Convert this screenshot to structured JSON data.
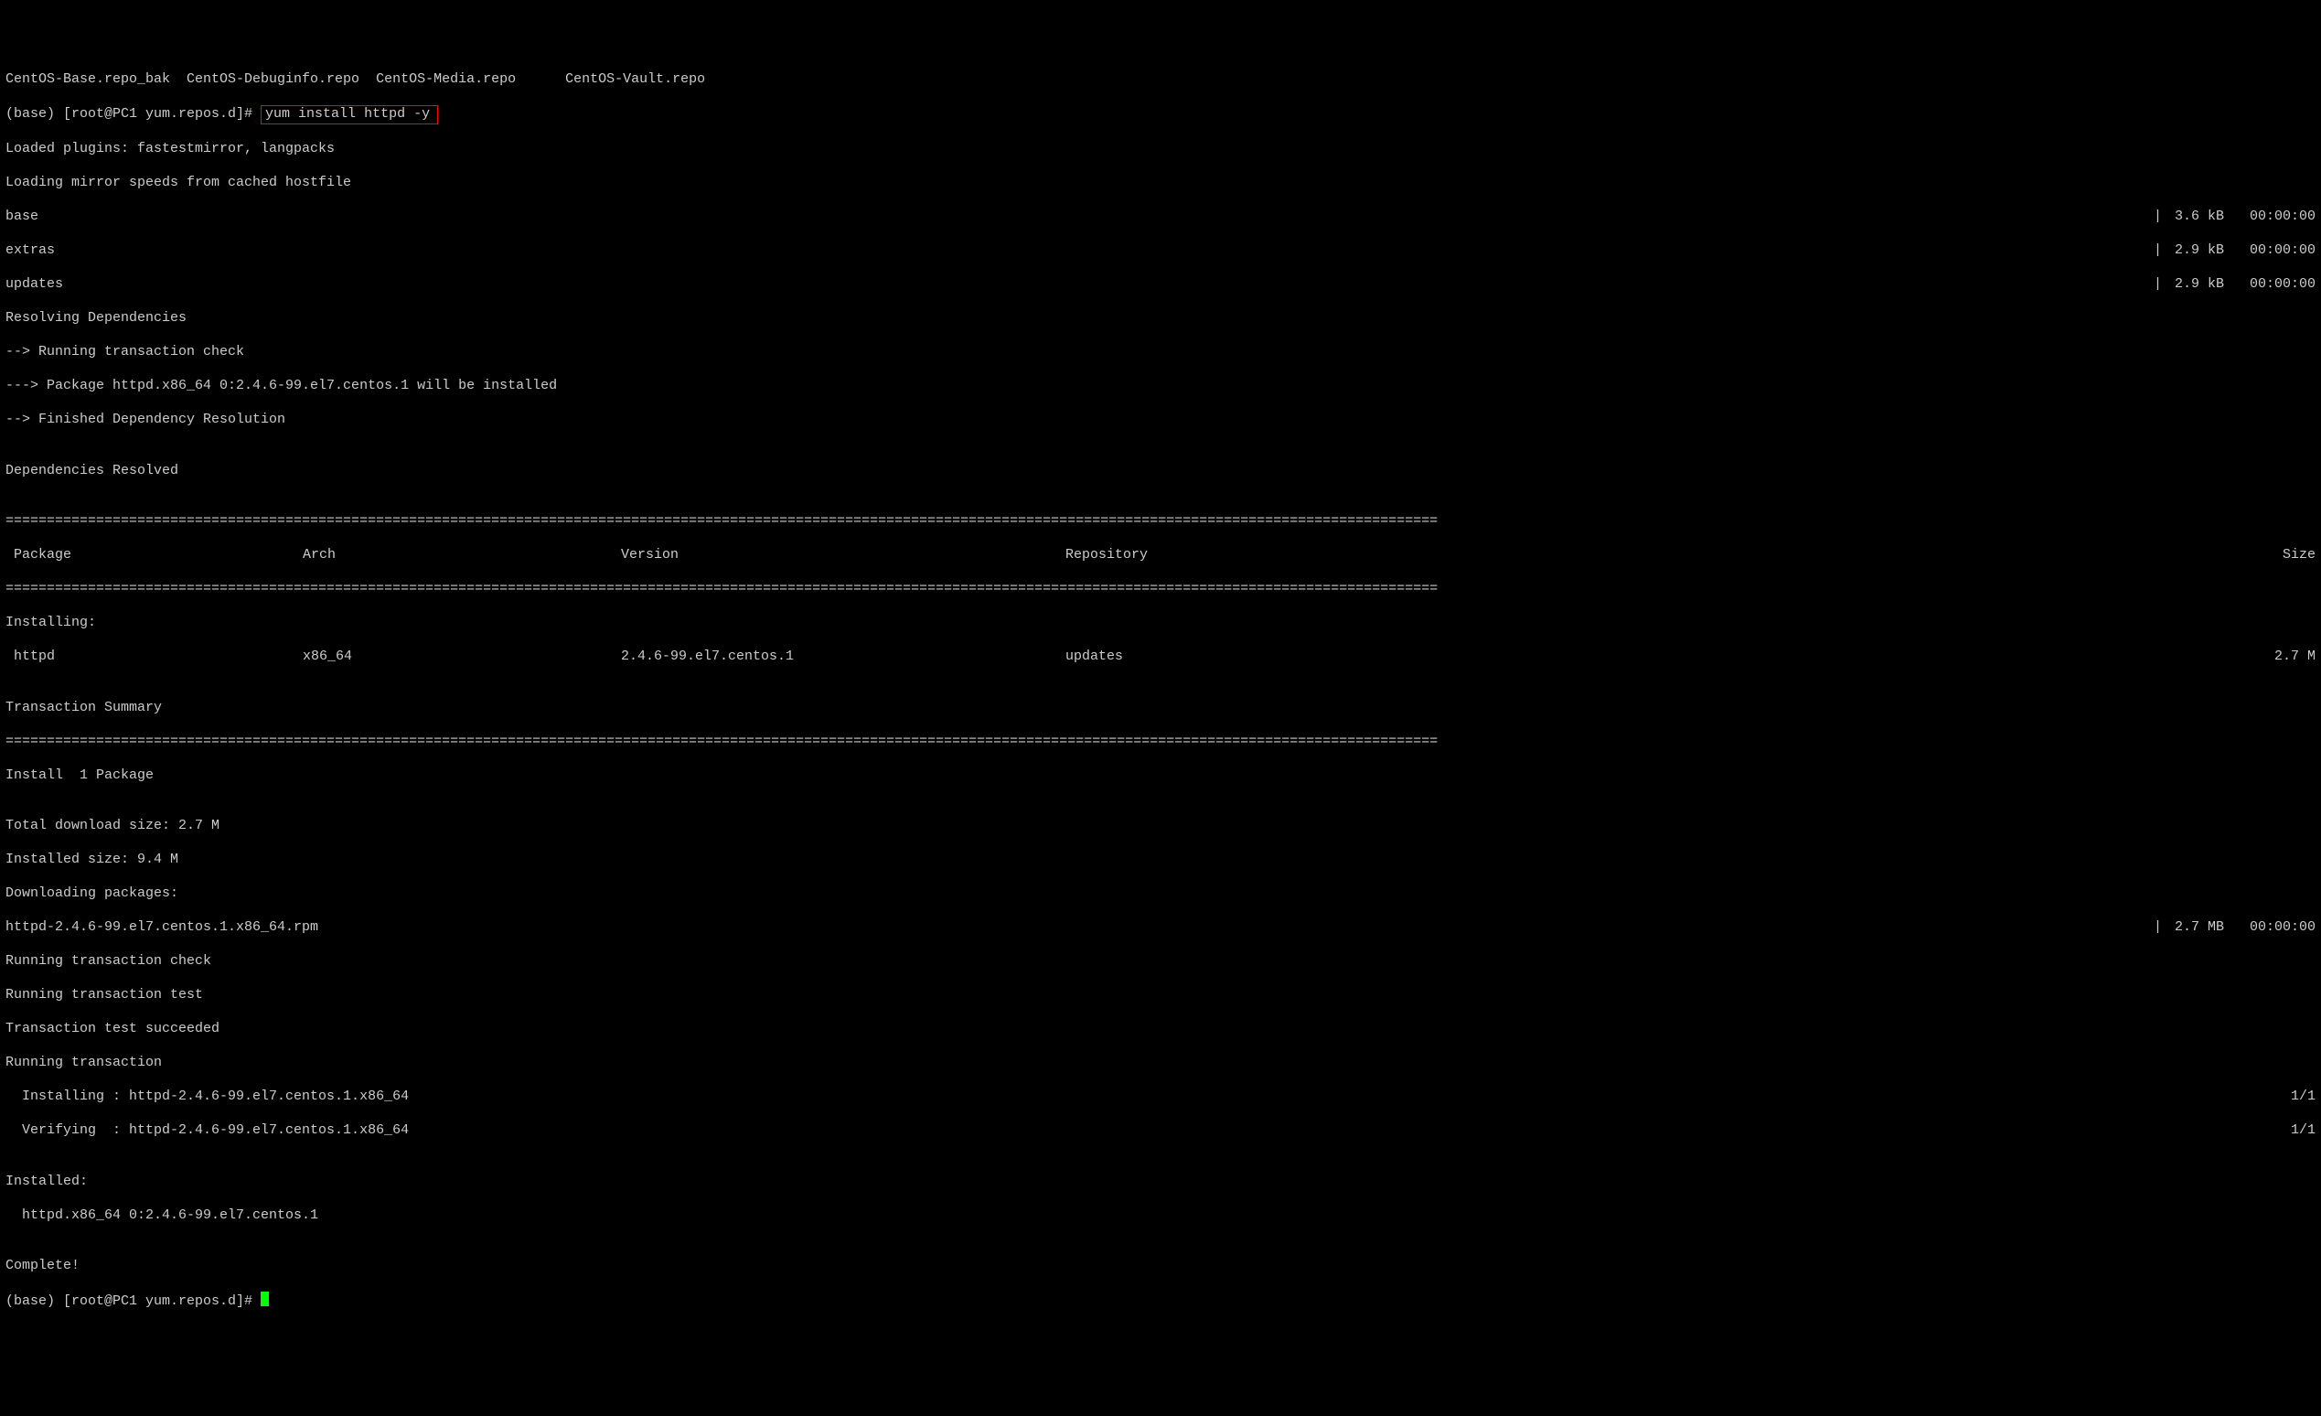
{
  "topfiles": "CentOS-Base.repo_bak  CentOS-Debuginfo.repo  CentOS-Media.repo      CentOS-Vault.repo",
  "prompt1_a": "(base) [root@PC1 yum.repos.d]# ",
  "prompt1_cmd": "yum install httpd -y",
  "pre": [
    "Loaded plugins: fastestmirror, langpacks",
    "Loading mirror speeds from cached hostfile"
  ],
  "repos": [
    {
      "name": "base",
      "size": "3.6 kB",
      "time": "00:00:00"
    },
    {
      "name": "extras",
      "size": "2.9 kB",
      "time": "00:00:00"
    },
    {
      "name": "updates",
      "size": "2.9 kB",
      "time": "00:00:00"
    }
  ],
  "dep": [
    "Resolving Dependencies",
    "--> Running transaction check",
    "---> Package httpd.x86_64 0:2.4.6-99.el7.centos.1 will be installed",
    "--> Finished Dependency Resolution",
    "",
    "Dependencies Resolved",
    ""
  ],
  "hdr": {
    "c1": " Package",
    "c2": "Arch",
    "c3": "Version",
    "c4": "Repository",
    "c5": "Size"
  },
  "installing": "Installing:",
  "pkg": {
    "c1": " httpd",
    "c2": "x86_64",
    "c3": "2.4.6-99.el7.centos.1",
    "c4": "updates",
    "c5": "2.7 M"
  },
  "summary": [
    "",
    "Transaction Summary"
  ],
  "install_line": "Install  1 Package",
  "totals": [
    "",
    "Total download size: 2.7 M",
    "Installed size: 9.4 M",
    "Downloading packages:"
  ],
  "dl": {
    "name": "httpd-2.4.6-99.el7.centos.1.x86_64.rpm",
    "size": "2.7 MB",
    "time": "00:00:00"
  },
  "trans": [
    "Running transaction check",
    "Running transaction test",
    "Transaction test succeeded",
    "Running transaction"
  ],
  "steps": [
    {
      "l": "  Installing : httpd-2.4.6-99.el7.centos.1.x86_64",
      "p": "1/1"
    },
    {
      "l": "  Verifying  : httpd-2.4.6-99.el7.centos.1.x86_64",
      "p": "1/1"
    }
  ],
  "installed": [
    "",
    "Installed:",
    "  httpd.x86_64 0:2.4.6-99.el7.centos.1",
    "",
    "Complete!"
  ],
  "prompt2": "(base) [root@PC1 yum.repos.d]# "
}
